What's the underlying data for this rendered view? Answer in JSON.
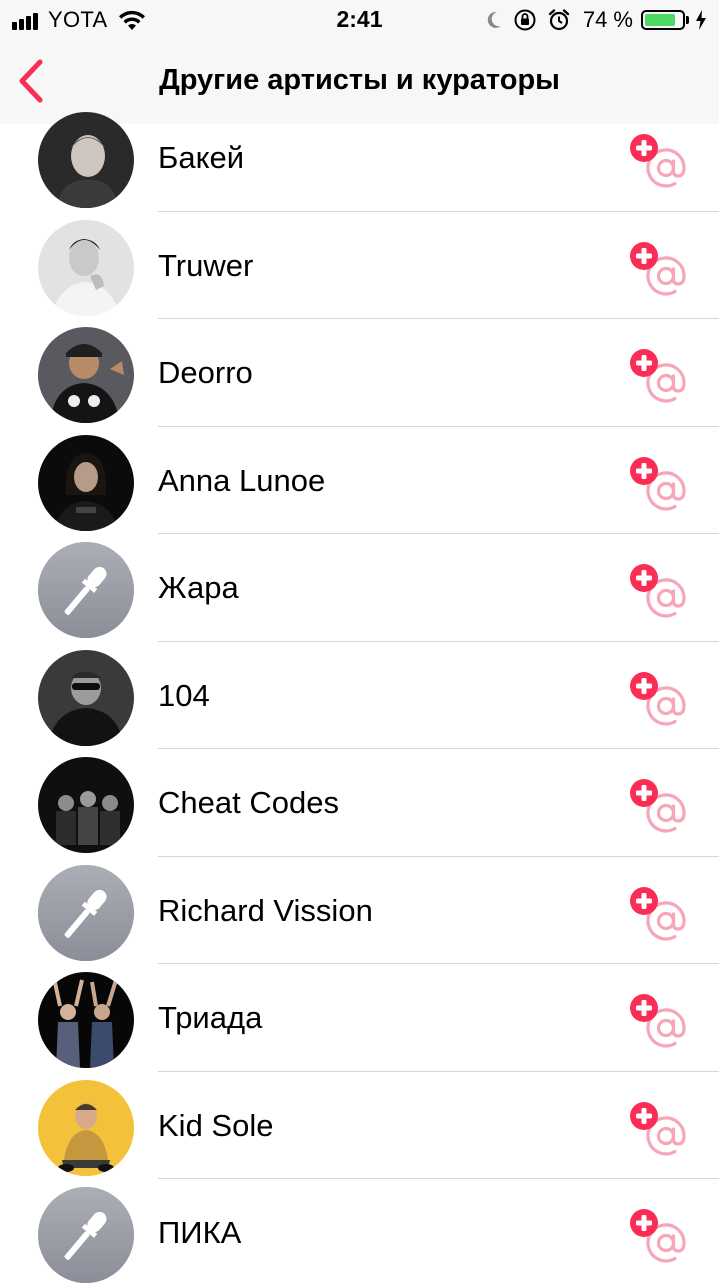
{
  "status_bar": {
    "carrier": "YOTA",
    "time": "2:41",
    "battery_percent": "74 %",
    "battery_level": 0.74,
    "icons": [
      "signal-icon",
      "wifi-icon",
      "moon-icon",
      "orientation-lock-icon",
      "alarm-icon",
      "battery-icon",
      "charging-icon"
    ]
  },
  "nav": {
    "title": "Другие артисты и кураторы",
    "back_icon": "chevron-left-icon"
  },
  "colors": {
    "accent": "#fa2d55",
    "accent_light": "#f6a6b8",
    "battery_green": "#4cd964",
    "divider": "#d6d6d9",
    "placeholder_avatar": "#9a9ca5"
  },
  "artists": [
    {
      "name": "Бакей",
      "avatar": "photo"
    },
    {
      "name": "Truwer",
      "avatar": "photo"
    },
    {
      "name": "Deorro",
      "avatar": "photo"
    },
    {
      "name": "Anna Lunoe",
      "avatar": "photo"
    },
    {
      "name": "Жара",
      "avatar": "microphone-placeholder"
    },
    {
      "name": "104",
      "avatar": "photo"
    },
    {
      "name": "Cheat Codes",
      "avatar": "photo"
    },
    {
      "name": "Richard Vission",
      "avatar": "microphone-placeholder"
    },
    {
      "name": "Триада",
      "avatar": "photo"
    },
    {
      "name": "Kid Sole",
      "avatar": "photo"
    },
    {
      "name": "ПИКА",
      "avatar": "microphone-placeholder"
    }
  ],
  "follow_icon": "follow-add-icon"
}
